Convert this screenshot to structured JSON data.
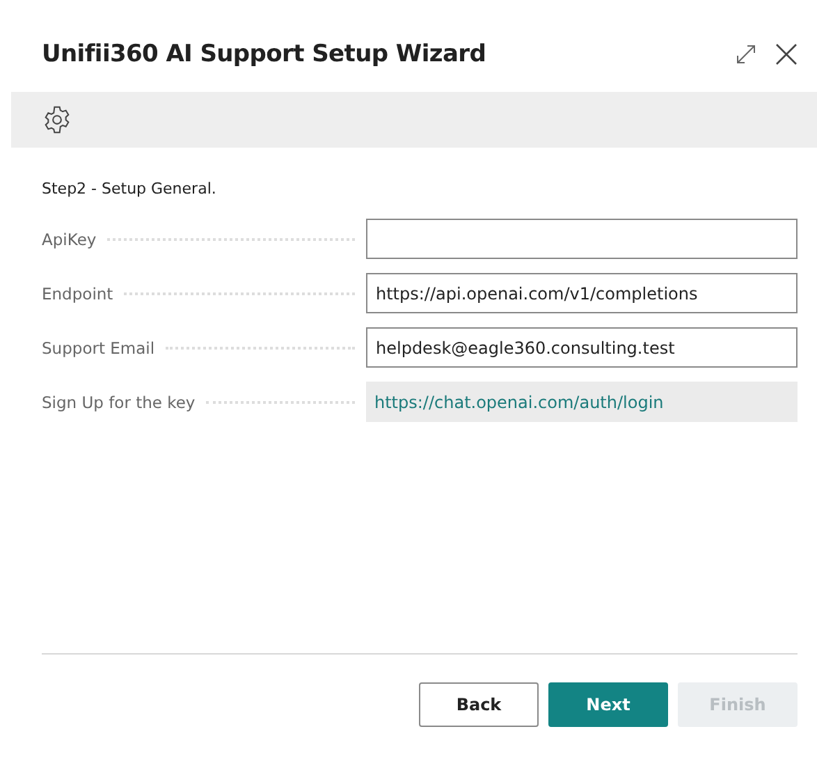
{
  "window": {
    "title": "Unifii360 AI Support Setup Wizard"
  },
  "step": "Step2 - Setup General.",
  "fields": [
    {
      "label": "ApiKey",
      "kind": "input"
    },
    {
      "label": "Endpoint",
      "kind": "input",
      "value": "https://api.openai.com/v1/completions"
    },
    {
      "label": "Support Email",
      "kind": "input",
      "value": "helpdesk@eagle360.consulting.test"
    },
    {
      "label": "Sign Up for the key",
      "kind": "link",
      "value": "https://chat.openai.com/auth/login"
    }
  ],
  "buttons": [
    {
      "label": "Back",
      "primary": false,
      "disabled": false
    },
    {
      "label": "Next",
      "primary": true,
      "disabled": false
    },
    {
      "label": "Finish",
      "primary": false,
      "disabled": true
    }
  ]
}
